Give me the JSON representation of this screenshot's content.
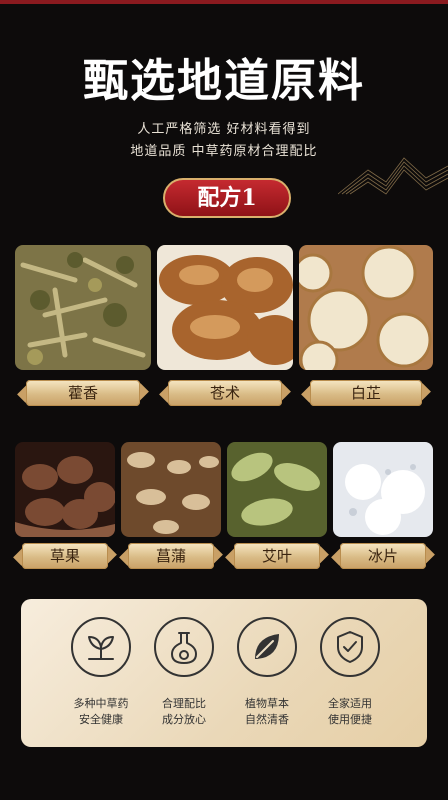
{
  "page": {
    "title": "甄选地道原料",
    "subtitle_line1": "人工严格筛选 好材料看得到",
    "subtitle_line2": "地道品质 中草药原材合理配比",
    "badge": "配方1"
  },
  "ingredients_row1": [
    {
      "name": "藿香",
      "photo": "patchouli-photo"
    },
    {
      "name": "苍术",
      "photo": "atractylodes-photo"
    },
    {
      "name": "白芷",
      "photo": "angelica-photo"
    }
  ],
  "ingredients_row2": [
    {
      "name": "草果",
      "photo": "tsaoko-photo"
    },
    {
      "name": "菖蒲",
      "photo": "calamus-photo"
    },
    {
      "name": "艾叶",
      "photo": "mugwort-photo"
    },
    {
      "name": "冰片",
      "photo": "borneol-photo"
    }
  ],
  "features": [
    {
      "icon": "herb-leaf-icon",
      "line1": "多种中草药",
      "line2": "安全健康"
    },
    {
      "icon": "flask-icon",
      "line1": "合理配比",
      "line2": "成分放心"
    },
    {
      "icon": "leaf-icon",
      "line1": "植物草本",
      "line2": "自然清香"
    },
    {
      "icon": "shield-check-icon",
      "line1": "全家适用",
      "line2": "使用便捷"
    }
  ],
  "colors": {
    "background": "#0d0b0b",
    "badge": "#b01e24",
    "gold": "#d9bb86",
    "panel": "#efe1c6"
  }
}
